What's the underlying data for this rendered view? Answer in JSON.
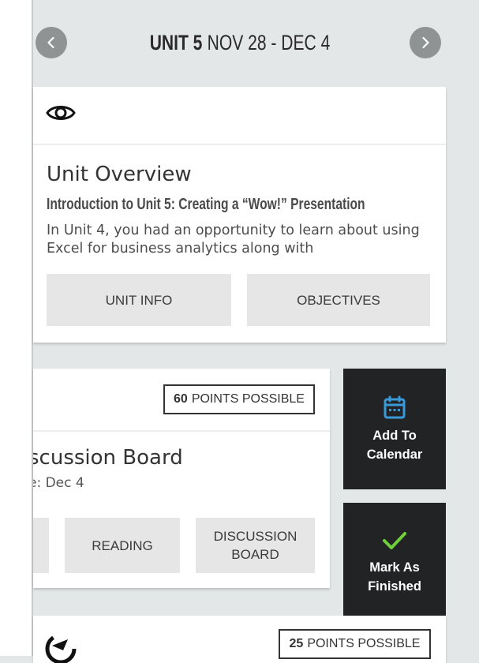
{
  "header": {
    "unit_label": "UNIT 5",
    "date_range": "NOV 28 - DEC 4",
    "prev_icon": "chevron-left-icon",
    "next_icon": "chevron-right-icon"
  },
  "overview": {
    "icon": "eye-icon",
    "title": "Unit Overview",
    "subtitle": "Introduction to Unit 5:  Creating a “Wow!” Presentation",
    "text": "In Unit 4, you had an opportunity to learn about using Excel for business analytics along with",
    "buttons": {
      "unit_info": "UNIT INFO",
      "objectives": "OBJECTIVES"
    }
  },
  "discussion": {
    "points": "60",
    "points_label": "POINTS POSSIBLE",
    "title": "scussion Board",
    "due": "e: Dec 4",
    "buttons": {
      "reading": "READING",
      "discussion_board": "DISCUSSION BOARD"
    }
  },
  "actions": {
    "add_to_calendar": "Add To Calendar",
    "mark_as_finished": "Mark As Finished",
    "calendar_icon_color": "#3a9ad9",
    "check_icon_color": "#6fcf3a"
  },
  "next_item": {
    "points": "25",
    "points_label": "POINTS POSSIBLE",
    "icon": "activity-icon"
  }
}
